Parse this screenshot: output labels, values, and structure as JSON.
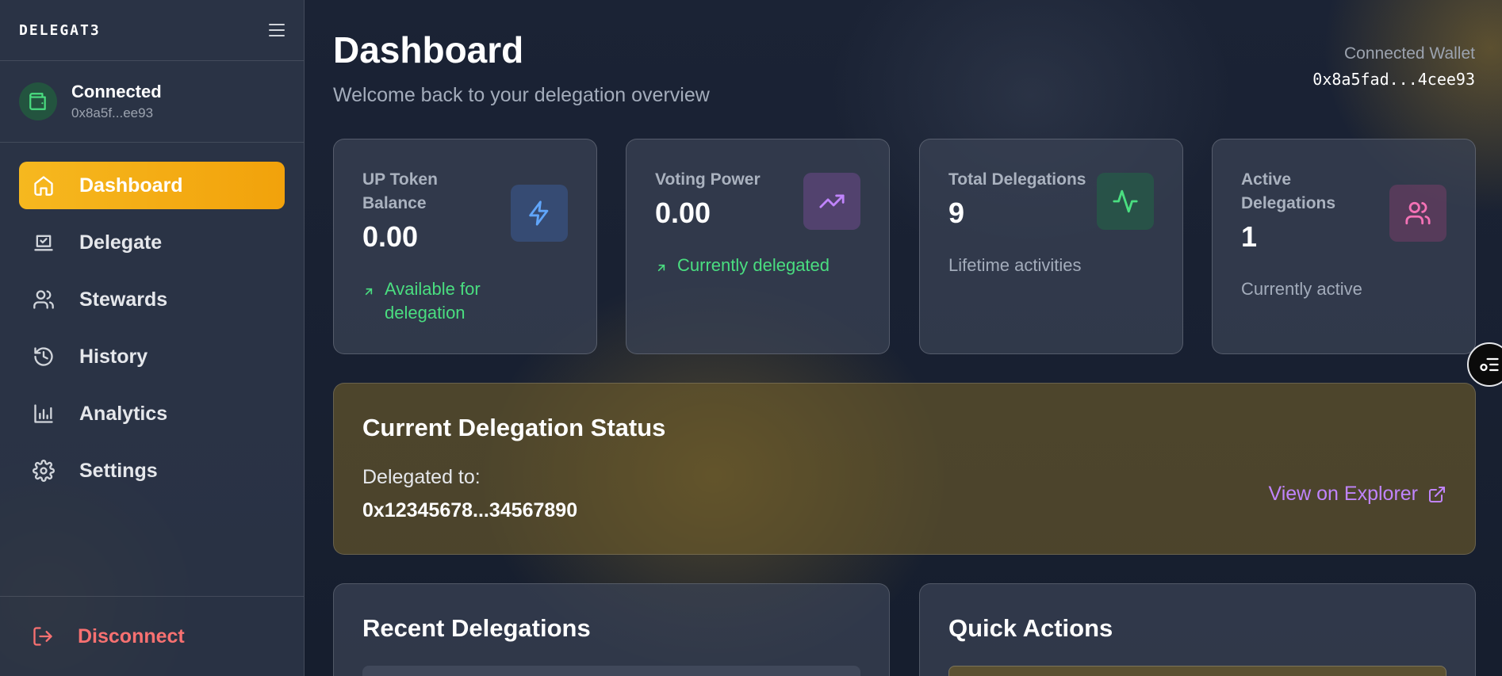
{
  "app": {
    "logo": "DELEGAT3"
  },
  "wallet": {
    "status": "Connected",
    "short_address": "0x8a5f...ee93"
  },
  "nav": {
    "items": [
      {
        "label": "Dashboard",
        "icon": "home-icon",
        "active": true
      },
      {
        "label": "Delegate",
        "icon": "vote-icon",
        "active": false
      },
      {
        "label": "Stewards",
        "icon": "users-icon",
        "active": false
      },
      {
        "label": "History",
        "icon": "history-icon",
        "active": false
      },
      {
        "label": "Analytics",
        "icon": "bar-chart-icon",
        "active": false
      },
      {
        "label": "Settings",
        "icon": "gear-icon",
        "active": false
      }
    ],
    "disconnect": "Disconnect"
  },
  "header": {
    "title": "Dashboard",
    "subtitle": "Welcome back to your delegation overview",
    "connected_wallet_label": "Connected Wallet",
    "connected_wallet_address": "0x8a5fad...4cee93"
  },
  "stats": [
    {
      "label": "UP Token Balance",
      "value": "0.00",
      "sub": "Available for delegation",
      "icon": "zap-icon",
      "accent": "#60a5fa"
    },
    {
      "label": "Voting Power",
      "value": "0.00",
      "sub": "Currently delegated",
      "icon": "trending-up-icon",
      "accent": "#c084fc"
    },
    {
      "label": "Total Delegations",
      "value": "9",
      "sub": "Lifetime activities",
      "icon": "activity-icon",
      "accent": "#4ade80"
    },
    {
      "label": "Active Delegations",
      "value": "1",
      "sub": "Currently active",
      "icon": "users-icon",
      "accent": "#f472b6"
    }
  ],
  "delegation_status": {
    "title": "Current Delegation Status",
    "delegated_label": "Delegated to:",
    "delegated_address": "0x12345678...34567890",
    "explorer_link": "View on Explorer"
  },
  "recent": {
    "title": "Recent Delegations"
  },
  "quick": {
    "title": "Quick Actions"
  },
  "colors": {
    "accent": "#f6b81f",
    "success": "#4ade80",
    "danger": "#f87171",
    "link": "#c084fc"
  }
}
